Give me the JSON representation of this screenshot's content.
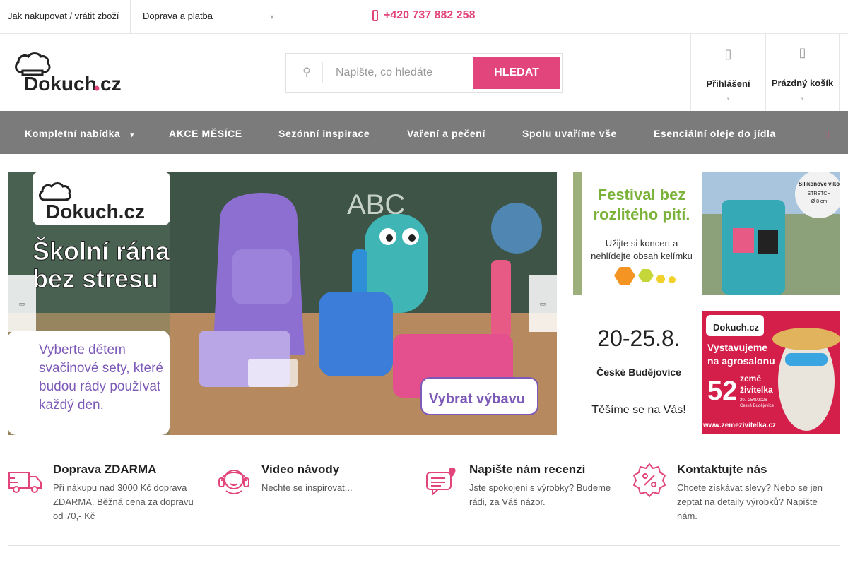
{
  "topbar": {
    "links": [
      "Jak nakupovat / vrátit zboží",
      "Doprava a platba"
    ],
    "more_icon": "chevron-down-icon",
    "phone": "+420 737 882 258"
  },
  "header": {
    "logo_text": "Dokuch.cz",
    "search": {
      "placeholder": "Napište, co hledáte",
      "button": "HLEDAT"
    },
    "login_label": "Přihlášení",
    "cart_label": "Prázdný košík"
  },
  "nav": {
    "items": [
      "Kompletní nabídka",
      "AKCE MĚSÍCE",
      "Sezónní inspirace",
      "Vaření a pečení",
      "Spolu uvaříme vše",
      "Esenciální oleje do jídla"
    ]
  },
  "hero": {
    "logo": "Dokuch.cz",
    "headline_1": "Školní rána",
    "headline_2": "bez stresu",
    "body_1": "Vyberte dětem",
    "body_2": "svačinové sety, které",
    "body_3": "budou rády používat",
    "body_4": "každý den.",
    "cta": "Vybrat výbavu"
  },
  "banner1": {
    "title_1": "Festival bez",
    "title_2": "rozlitého pití.",
    "sub_1": "Užijte si koncert a",
    "sub_2": "nehlídejte obsah kelímku",
    "badge_1": "Silikonové víko",
    "badge_2": "STRETCH",
    "badge_3": "Ø 8 cm"
  },
  "banner2": {
    "dates": "20-25.8.",
    "city": "České Budějovice",
    "greeting": "Těšíme se na Vás!",
    "logo": "Dokuch.cz",
    "headline_1": "Vystavujeme",
    "headline_2": "na agrosalonu",
    "fair_number": "52",
    "fair_name_1": "země",
    "fair_name_2": "živitelka",
    "fair_dates": "20.–25/8/2026",
    "fair_city": "České Budějovice",
    "url": "www.zemezivitelka.cz"
  },
  "features": [
    {
      "title": "Doprava ZDARMA",
      "desc": "Při nákupu nad 3000 Kč doprava ZDARMA. Běžná cena za dopravu od 70,- Kč",
      "icon": "truck-icon"
    },
    {
      "title": "Video návody",
      "desc": "Nechte se inspirovat...",
      "icon": "headset-icon"
    },
    {
      "title": "Napište nám recenzi",
      "desc": "Jste spokojeni s výrobky? Budeme rádi, za Váš názor.",
      "icon": "review-icon"
    },
    {
      "title": "Kontaktujte nás",
      "desc": "Chcete získávat slevy? Nebo se jen zeptat na detaily výrobků? Napište nám.",
      "icon": "discount-badge-icon"
    }
  ],
  "colors": {
    "accent": "#e2457c",
    "nav_bg": "#7b7b7b"
  }
}
